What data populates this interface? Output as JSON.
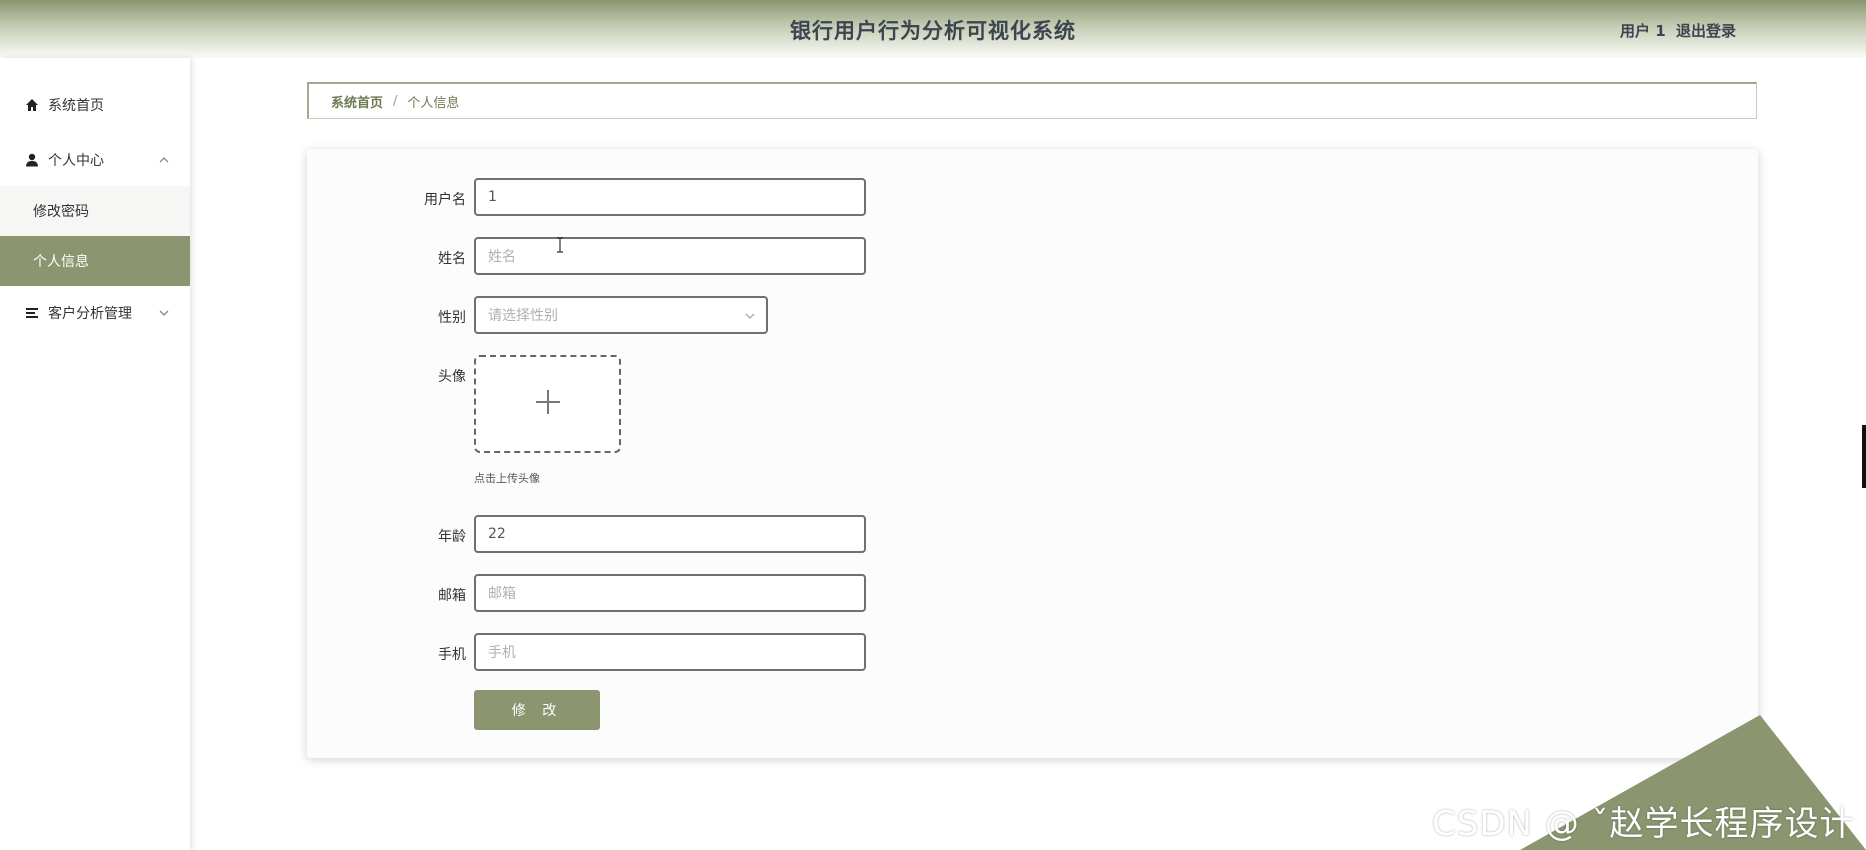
{
  "header": {
    "title": "银行用户行为分析可视化系统",
    "user": "用户 1",
    "logout": "退出登录"
  },
  "sidebar": {
    "items": [
      {
        "label": "系统首页",
        "icon": "home-icon"
      },
      {
        "label": "个人中心",
        "icon": "user-icon",
        "expanded": true,
        "children": [
          {
            "label": "修改密码"
          },
          {
            "label": "个人信息",
            "active": true
          }
        ]
      },
      {
        "label": "客户分析管理",
        "icon": "list-icon",
        "expanded": false
      }
    ]
  },
  "breadcrumb": {
    "home": "系统首页",
    "separator": "/",
    "current": "个人信息"
  },
  "form": {
    "username": {
      "label": "用户名",
      "value": "1"
    },
    "name": {
      "label": "姓名",
      "placeholder": "姓名"
    },
    "gender": {
      "label": "性别",
      "placeholder": "请选择性别"
    },
    "avatar": {
      "label": "头像",
      "tip": "点击上传头像"
    },
    "age": {
      "label": "年龄",
      "value": "22"
    },
    "email": {
      "label": "邮箱",
      "placeholder": "邮箱"
    },
    "phone": {
      "label": "手机",
      "placeholder": "手机"
    },
    "submit": "修 改"
  },
  "watermark": "CSDN @ ˇ赵学长程序设计",
  "colors": {
    "accent": "#8b9670",
    "accent_dark": "#6d7a52",
    "header_text": "#3c4550"
  }
}
